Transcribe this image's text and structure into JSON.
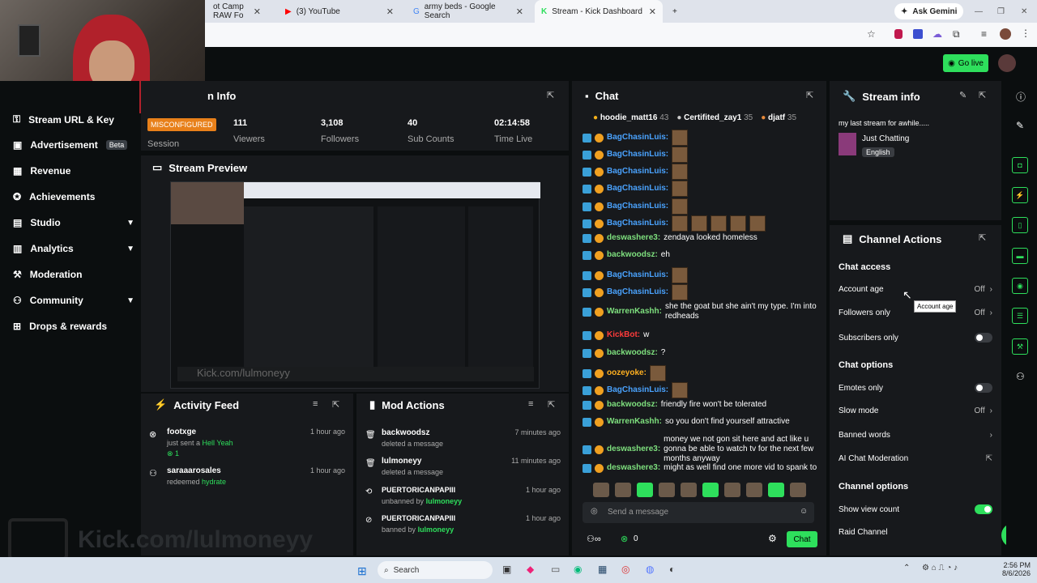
{
  "browser": {
    "tabs": [
      {
        "label": "ot Camp RAW Fo",
        "active": false
      },
      {
        "label": "(3) YouTube",
        "active": false
      },
      {
        "label": "army beds - Google Search",
        "active": false
      },
      {
        "label": "Stream - Kick Dashboard",
        "active": true
      }
    ],
    "ask_gemini": "Ask Gemini"
  },
  "kick": {
    "go_live": "Go live"
  },
  "sidebar": {
    "items": [
      {
        "label": "Stream URL & Key",
        "icon": "key-icon"
      },
      {
        "label": "Advertisement",
        "icon": "ad-icon",
        "badge": "Beta"
      },
      {
        "label": "Revenue",
        "icon": "revenue-icon"
      },
      {
        "label": "Achievements",
        "icon": "trophy-icon"
      },
      {
        "label": "Studio",
        "icon": "studio-icon",
        "expandable": true
      },
      {
        "label": "Analytics",
        "icon": "chart-icon",
        "expandable": true
      },
      {
        "label": "Moderation",
        "icon": "hammer-icon"
      },
      {
        "label": "Community",
        "icon": "community-icon",
        "expandable": true
      },
      {
        "label": "Drops & rewards",
        "icon": "gift-icon"
      }
    ]
  },
  "session": {
    "title": "n Info",
    "status": "MISCONFIGURED",
    "session_label": "Session",
    "stats": [
      {
        "value": "111",
        "label": "Viewers"
      },
      {
        "value": "3,108",
        "label": "Followers"
      },
      {
        "value": "40",
        "label": "Sub Counts"
      },
      {
        "value": "02:14:58",
        "label": "Time Live"
      }
    ]
  },
  "preview": {
    "title": "Stream Preview"
  },
  "chat": {
    "title": "Chat",
    "top_gifters": [
      {
        "name": "hoodie_matt16",
        "count": "43"
      },
      {
        "name": "Certifited_zay1",
        "count": "35"
      },
      {
        "name": "djatf",
        "count": "35"
      }
    ],
    "messages": [
      {
        "user": "BagChasinLuis",
        "text": "",
        "color": "#4aa3ff"
      },
      {
        "user": "BagChasinLuis",
        "text": "",
        "color": "#4aa3ff"
      },
      {
        "user": "BagChasinLuis",
        "text": "",
        "color": "#4aa3ff"
      },
      {
        "user": "BagChasinLuis",
        "text": "",
        "color": "#4aa3ff"
      },
      {
        "user": "BagChasinLuis",
        "text": "",
        "color": "#4aa3ff"
      },
      {
        "user": "BagChasinLuis",
        "text": "",
        "color": "#4aa3ff"
      },
      {
        "user": "deswashere3",
        "text": "zendaya looked homeless",
        "color": "#7ee07e"
      },
      {
        "user": "backwoodsz",
        "text": "eh",
        "color": "#7ee07e"
      },
      {
        "user": "BagChasinLuis",
        "text": "",
        "color": "#4aa3ff"
      },
      {
        "user": "BagChasinLuis",
        "text": "",
        "color": "#4aa3ff"
      },
      {
        "user": "WarrenKashh",
        "text": "she the goat but she ain't my type. I'm into redheads",
        "color": "#7ee07e"
      },
      {
        "user": "KickBot",
        "text": "w",
        "color": "#ff3b3b"
      },
      {
        "user": "backwoodsz",
        "text": "?",
        "color": "#7ee07e"
      },
      {
        "user": "oozeyoke",
        "text": "",
        "color": "#ffb020"
      },
      {
        "user": "BagChasinLuis",
        "text": "",
        "color": "#4aa3ff"
      },
      {
        "user": "backwoodsz",
        "text": "friendly fire won't be tolerated",
        "color": "#7ee07e"
      },
      {
        "user": "WarrenKashh",
        "text": "so you don't find yourself attractive",
        "color": "#7ee07e"
      },
      {
        "user": "deswashere3",
        "text": "money we not gon sit here and act like u gonna be able to watch tv for the next few months anyway",
        "color": "#7ee07e"
      },
      {
        "user": "deswashere3",
        "text": "might as well find one more vid to spank to",
        "color": "#7ee07e"
      }
    ],
    "input_placeholder": "Send a message",
    "points": "0",
    "send_label": "Chat"
  },
  "stream_info": {
    "title": "Stream info",
    "stream_title": "my last stream for awhile.....",
    "category": "Just Chatting",
    "language": "English"
  },
  "channel_actions": {
    "title": "Channel Actions",
    "chat_access_title": "Chat access",
    "account_age": "Account age",
    "account_age_value": "Off",
    "tooltip": "Account age",
    "followers_only": "Followers only",
    "followers_only_value": "Off",
    "subscribers_only": "Subscribers only",
    "chat_options_title": "Chat options",
    "emotes_only": "Emotes only",
    "slow_mode": "Slow mode",
    "slow_mode_value": "Off",
    "banned_words": "Banned words",
    "ai_moderation": "AI Chat Moderation",
    "channel_options_title": "Channel options",
    "show_view_count": "Show view count",
    "raid_channel": "Raid Channel"
  },
  "activity": {
    "title": "Activity Feed",
    "items": [
      {
        "user": "footxge",
        "line": "just sent a",
        "highlight": "Hell Yeah",
        "extra": "1",
        "time": "1 hour ago"
      },
      {
        "user": "saraaarosales",
        "line": "redeemed",
        "highlight": "hydrate",
        "time": "1 hour ago"
      }
    ]
  },
  "mod_actions": {
    "title": "Mod Actions",
    "items": [
      {
        "user": "backwoodsz",
        "action": "deleted a message",
        "time": "7 minutes ago"
      },
      {
        "user": "lulmoneyy",
        "action": "deleted a message",
        "time": "11 minutes ago"
      },
      {
        "user": "PUERTORICANPAPIII",
        "action": "unbanned by",
        "by": "lulmoneyy",
        "time": "1 hour ago"
      },
      {
        "user": "PUERTORICANPAPIII",
        "action": "banned by",
        "by": "lulmoneyy",
        "time": "1 hour ago"
      }
    ]
  },
  "watermark": "Kick.com/lulmoneyy",
  "taskbar": {
    "search": "Search",
    "time": "2:56 PM",
    "date": "8/6/2026"
  }
}
